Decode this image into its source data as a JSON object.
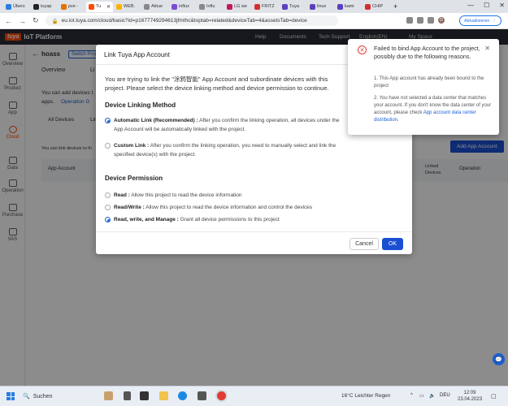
{
  "browser": {
    "tabs": [
      {
        "label": "Übers",
        "color": "#2a7de1",
        "icon": "page-icon"
      },
      {
        "label": "tuyap",
        "color": "#222222",
        "icon": "github-icon"
      },
      {
        "label": "pve -",
        "color": "#e57200",
        "icon": "proxmox-icon"
      },
      {
        "label": "Tu",
        "color": "#ff4800",
        "icon": "tuya-icon",
        "active": true
      },
      {
        "label": "WEB.",
        "color": "#ffb300",
        "icon": "web-icon"
      },
      {
        "label": "Aktue",
        "color": "#888888",
        "icon": "page-icon"
      },
      {
        "label": "influx",
        "color": "#7b4dd6",
        "icon": "influx-icon"
      },
      {
        "label": "Influ",
        "color": "#888888",
        "icon": "page-icon"
      },
      {
        "label": "LG we",
        "color": "#c2185b",
        "icon": "lg-icon"
      },
      {
        "label": "FRITZ",
        "color": "#d32f2f",
        "icon": "fritz-icon"
      },
      {
        "label": "Tuya",
        "color": "#5c3fbd",
        "icon": "yahoo-icon"
      },
      {
        "label": "linux",
        "color": "#5c3fbd",
        "icon": "yahoo-icon"
      },
      {
        "label": "kami",
        "color": "#5c3fbd",
        "icon": "yahoo-icon"
      },
      {
        "label": "CHIP",
        "color": "#d32f2f",
        "icon": "chip-icon"
      }
    ],
    "url": "eu.iot.tuya.com/cloud/basic?id=p1677749294613jfmthc&toptab=related&deviceTab=4&assetsTab=device",
    "update_label": "Aktualisieren",
    "profile_initial": "D"
  },
  "app": {
    "logo_text": "IoT Platform",
    "logo_brand": "tuya",
    "nav": [
      "Help",
      "Documents",
      "Tech Support",
      "English(EN)",
      "My Space"
    ],
    "sidebar": [
      {
        "label": "Overview",
        "icon": "overview-icon"
      },
      {
        "label": "Product",
        "icon": "product-icon"
      },
      {
        "label": "App",
        "icon": "app-icon"
      },
      {
        "label": "Cloud",
        "icon": "cloud-icon",
        "active": true
      },
      {
        "label": "Data",
        "icon": "data-icon"
      },
      {
        "label": "Operation",
        "icon": "operation-icon"
      },
      {
        "label": "Purchase",
        "icon": "purchase-icon"
      },
      {
        "label": "VAS",
        "icon": "vas-icon"
      }
    ],
    "project_name": "hoass",
    "switch_project": "Switch Proj",
    "tabs": [
      "Overview",
      "Li"
    ],
    "info_text": "You can add devices t",
    "info_text2": "apps.",
    "operation_link": "Operation G",
    "subtab": "All Devices",
    "subtab2": "Lin",
    "link_devices_text": "You can link devices to th",
    "add_app_account": "Add App Account",
    "table_headers": [
      "App Account",
      "Linked Devices",
      "Operation"
    ]
  },
  "modal": {
    "title": "Link Tuya App Account",
    "intro": "You are trying to link the \"涂鸦智能\" App Account and subordinate devices with this project. Please select the device linking method and device permission to continue.",
    "section_linking": "Device Linking Method",
    "linking_options": [
      {
        "label": "Automatic Link (Recommended) :",
        "desc": "After you confirm the linking operation, all devices under the App Account will be automatically linked with the project.",
        "selected": true
      },
      {
        "label": "Custom Link :",
        "desc": "After you confirm the linking operation, you need to manually select and link the specified device(s) with the project.",
        "selected": false
      }
    ],
    "section_permission": "Device Permission",
    "permission_options": [
      {
        "label": "Read :",
        "desc": "Allow this project to read the device information",
        "selected": false
      },
      {
        "label": "Read/Write :",
        "desc": "Allow this project to read the device information and control the devices",
        "selected": false
      },
      {
        "label": "Read, write, and Manage :",
        "desc": "Grant all device permissions to this project",
        "selected": true
      }
    ],
    "cancel": "Cancel",
    "ok": "OK"
  },
  "error": {
    "title": "Failed to bind App Account to the project, possibly due to the following reasons.",
    "reason1": "1. This App account has already been bound to the project",
    "reason2": "2. You have not selected a data center that matches your account. If you don't know the data center of your account, please check",
    "reason2_link": "App account data center distribution",
    "reason2_end": "."
  },
  "taskbar": {
    "search": "Suchen",
    "weather": "16°C  Leichter Regen",
    "lang": "DEU",
    "time": "12:09",
    "date": "23.04.2023"
  }
}
